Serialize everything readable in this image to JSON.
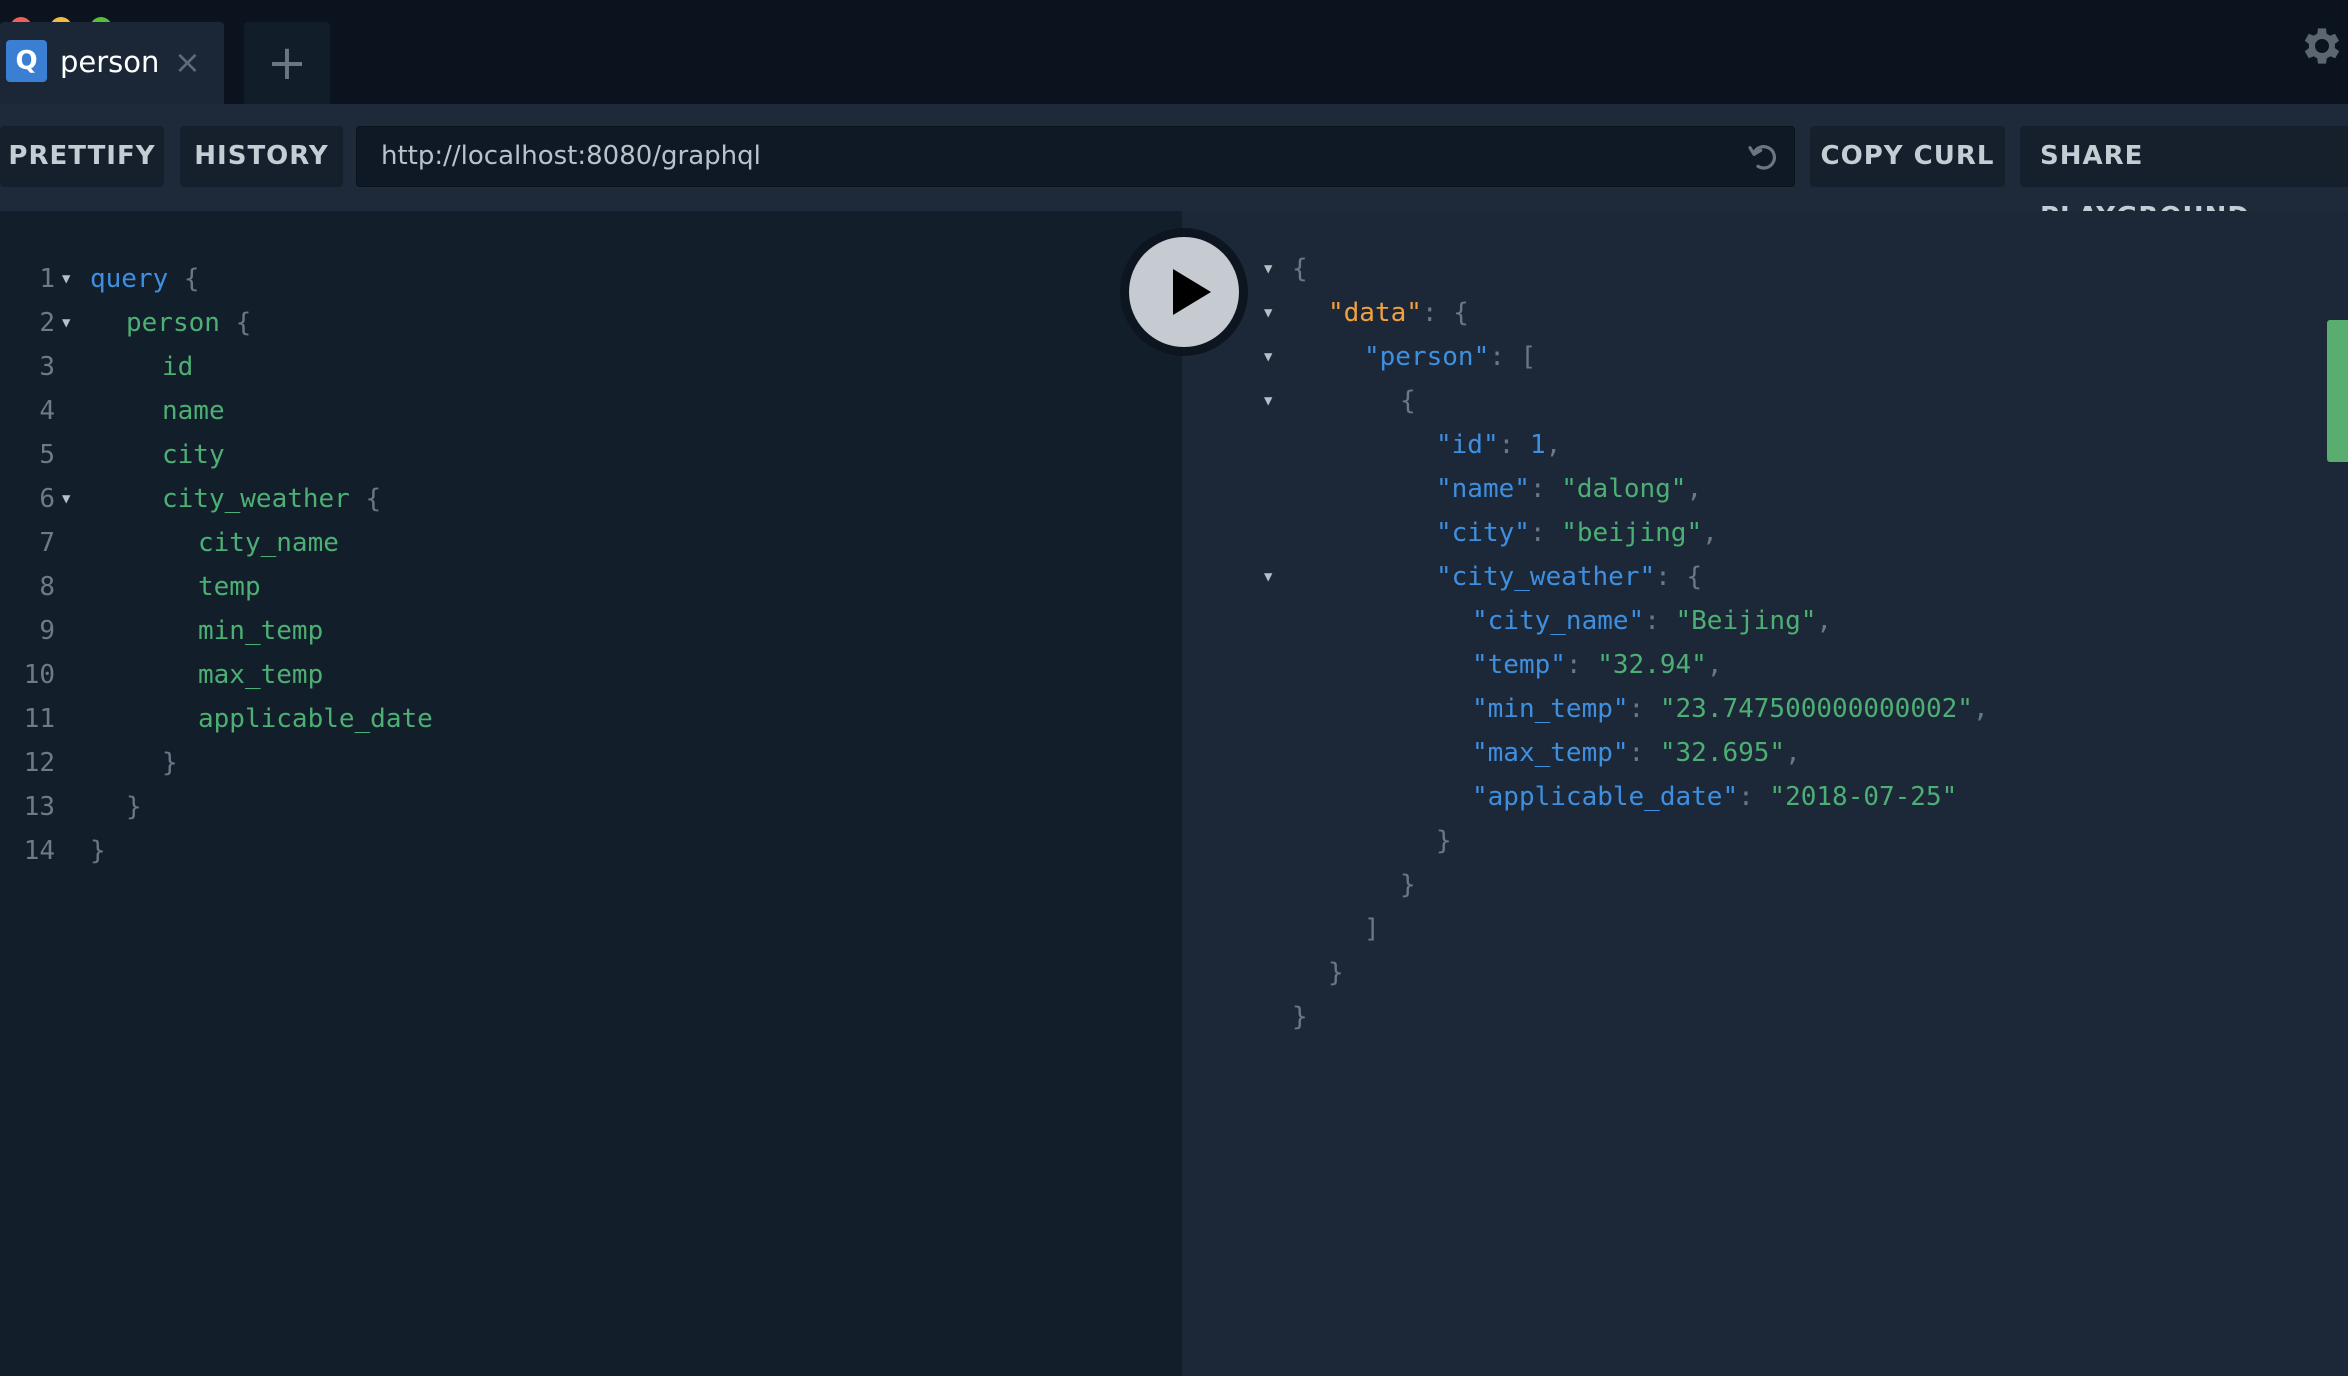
{
  "window": {
    "traffic_lights": {
      "close": "#f25f57",
      "minimize": "#f6ba3f",
      "maximize": "#57c038"
    }
  },
  "tabs": [
    {
      "badge": "Q",
      "label": "person",
      "close_icon": "×",
      "active": true
    }
  ],
  "new_tab_icon": "+",
  "settings_icon": "gear-icon",
  "toolbar": {
    "prettify_label": "PRETTIFY",
    "history_label": "HISTORY",
    "endpoint_url": "http://localhost:8080/graphql",
    "reload_icon": "reload-icon",
    "copy_curl_label": "COPY CURL",
    "share_label": "SHARE PLAYGROUND"
  },
  "editor": {
    "lines": [
      {
        "n": "1",
        "fold": true,
        "indent": 0,
        "tokens": [
          {
            "t": "query",
            "c": "kw"
          },
          {
            "t": " {",
            "c": "pun"
          }
        ]
      },
      {
        "n": "2",
        "fold": true,
        "indent": 1,
        "tokens": [
          {
            "t": "person",
            "c": "fld"
          },
          {
            "t": " {",
            "c": "pun"
          }
        ]
      },
      {
        "n": "3",
        "fold": false,
        "indent": 2,
        "tokens": [
          {
            "t": "id",
            "c": "fld"
          }
        ]
      },
      {
        "n": "4",
        "fold": false,
        "indent": 2,
        "tokens": [
          {
            "t": "name",
            "c": "fld"
          }
        ]
      },
      {
        "n": "5",
        "fold": false,
        "indent": 2,
        "tokens": [
          {
            "t": "city",
            "c": "fld"
          }
        ]
      },
      {
        "n": "6",
        "fold": true,
        "indent": 2,
        "tokens": [
          {
            "t": "city_weather",
            "c": "fld"
          },
          {
            "t": " {",
            "c": "pun"
          }
        ]
      },
      {
        "n": "7",
        "fold": false,
        "indent": 3,
        "tokens": [
          {
            "t": "city_name",
            "c": "fld"
          }
        ]
      },
      {
        "n": "8",
        "fold": false,
        "indent": 3,
        "tokens": [
          {
            "t": "temp",
            "c": "fld"
          }
        ]
      },
      {
        "n": "9",
        "fold": false,
        "indent": 3,
        "tokens": [
          {
            "t": "min_temp",
            "c": "fld"
          }
        ]
      },
      {
        "n": "10",
        "fold": false,
        "indent": 3,
        "tokens": [
          {
            "t": "max_temp",
            "c": "fld"
          }
        ]
      },
      {
        "n": "11",
        "fold": false,
        "indent": 3,
        "tokens": [
          {
            "t": "applicable_date",
            "c": "fld"
          }
        ]
      },
      {
        "n": "12",
        "fold": false,
        "indent": 2,
        "tokens": [
          {
            "t": "}",
            "c": "pun"
          }
        ]
      },
      {
        "n": "13",
        "fold": false,
        "indent": 1,
        "tokens": [
          {
            "t": "}",
            "c": "pun"
          }
        ]
      },
      {
        "n": "14",
        "fold": false,
        "indent": 0,
        "tokens": [
          {
            "t": "}",
            "c": "pun"
          }
        ]
      }
    ]
  },
  "result": {
    "lines": [
      {
        "fold": true,
        "indent": 0,
        "tokens": [
          {
            "t": "{",
            "c": "pun"
          }
        ]
      },
      {
        "fold": true,
        "indent": 1,
        "tokens": [
          {
            "t": "\"data\"",
            "c": "dkey"
          },
          {
            "t": ": {",
            "c": "pun"
          }
        ]
      },
      {
        "fold": true,
        "indent": 2,
        "tokens": [
          {
            "t": "\"person\"",
            "c": "key"
          },
          {
            "t": ": [",
            "c": "pun"
          }
        ]
      },
      {
        "fold": true,
        "indent": 3,
        "tokens": [
          {
            "t": "{",
            "c": "pun"
          }
        ]
      },
      {
        "fold": false,
        "indent": 4,
        "tokens": [
          {
            "t": "\"id\"",
            "c": "key"
          },
          {
            "t": ": ",
            "c": "pun"
          },
          {
            "t": "1",
            "c": "num"
          },
          {
            "t": ",",
            "c": "pun"
          }
        ]
      },
      {
        "fold": false,
        "indent": 4,
        "tokens": [
          {
            "t": "\"name\"",
            "c": "key"
          },
          {
            "t": ": ",
            "c": "pun"
          },
          {
            "t": "\"dalong\"",
            "c": "str"
          },
          {
            "t": ",",
            "c": "pun"
          }
        ]
      },
      {
        "fold": false,
        "indent": 4,
        "tokens": [
          {
            "t": "\"city\"",
            "c": "key"
          },
          {
            "t": ": ",
            "c": "pun"
          },
          {
            "t": "\"beijing\"",
            "c": "str"
          },
          {
            "t": ",",
            "c": "pun"
          }
        ]
      },
      {
        "fold": true,
        "indent": 4,
        "tokens": [
          {
            "t": "\"city_weather\"",
            "c": "key"
          },
          {
            "t": ": {",
            "c": "pun"
          }
        ]
      },
      {
        "fold": false,
        "indent": 5,
        "tokens": [
          {
            "t": "\"city_name\"",
            "c": "key"
          },
          {
            "t": ": ",
            "c": "pun"
          },
          {
            "t": "\"Beijing\"",
            "c": "str"
          },
          {
            "t": ",",
            "c": "pun"
          }
        ]
      },
      {
        "fold": false,
        "indent": 5,
        "tokens": [
          {
            "t": "\"temp\"",
            "c": "key"
          },
          {
            "t": ": ",
            "c": "pun"
          },
          {
            "t": "\"32.94\"",
            "c": "str"
          },
          {
            "t": ",",
            "c": "pun"
          }
        ]
      },
      {
        "fold": false,
        "indent": 5,
        "tokens": [
          {
            "t": "\"min_temp\"",
            "c": "key"
          },
          {
            "t": ": ",
            "c": "pun"
          },
          {
            "t": "\"23.747500000000002\"",
            "c": "str"
          },
          {
            "t": ",",
            "c": "pun"
          }
        ]
      },
      {
        "fold": false,
        "indent": 5,
        "tokens": [
          {
            "t": "\"max_temp\"",
            "c": "key"
          },
          {
            "t": ": ",
            "c": "pun"
          },
          {
            "t": "\"32.695\"",
            "c": "str"
          },
          {
            "t": ",",
            "c": "pun"
          }
        ]
      },
      {
        "fold": false,
        "indent": 5,
        "tokens": [
          {
            "t": "\"applicable_date\"",
            "c": "key"
          },
          {
            "t": ": ",
            "c": "pun"
          },
          {
            "t": "\"2018-07-25\"",
            "c": "str"
          }
        ]
      },
      {
        "fold": false,
        "indent": 4,
        "tokens": [
          {
            "t": "}",
            "c": "pun"
          }
        ]
      },
      {
        "fold": false,
        "indent": 3,
        "tokens": [
          {
            "t": "}",
            "c": "pun"
          }
        ]
      },
      {
        "fold": false,
        "indent": 2,
        "tokens": [
          {
            "t": "]",
            "c": "pun"
          }
        ]
      },
      {
        "fold": false,
        "indent": 1,
        "tokens": [
          {
            "t": "}",
            "c": "pun"
          }
        ]
      },
      {
        "fold": false,
        "indent": 0,
        "tokens": [
          {
            "t": "}",
            "c": "pun"
          }
        ]
      }
    ]
  },
  "play_button_label": "Execute query",
  "colors": {
    "accent_blue": "#3e8fe0",
    "field_green": "#4caf73",
    "data_key_orange": "#f2a13c",
    "scroll_indicator": "#58ad6f"
  }
}
